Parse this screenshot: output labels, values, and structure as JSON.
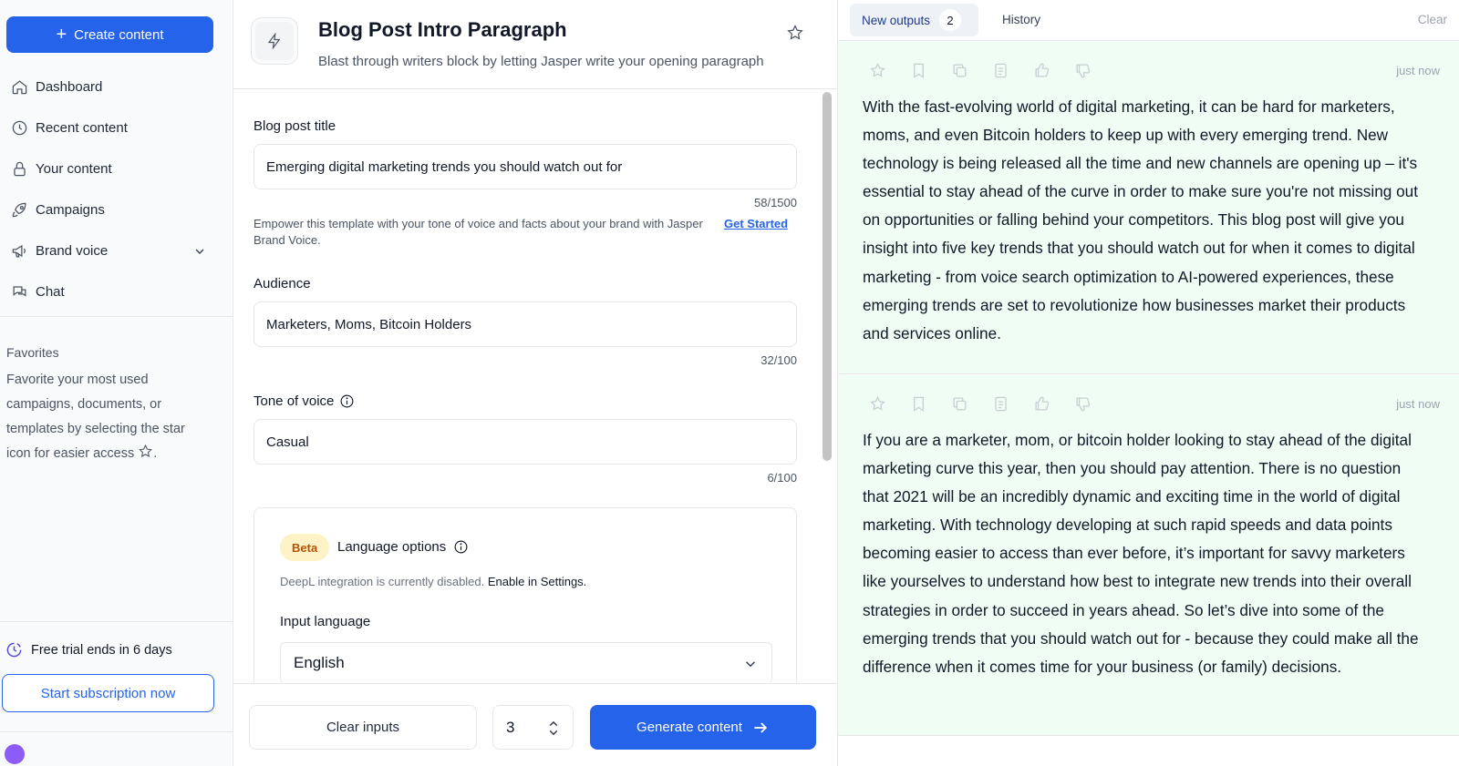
{
  "sidebar": {
    "create_label": "Create content",
    "nav": [
      {
        "label": "Dashboard",
        "icon": "home-icon"
      },
      {
        "label": "Recent content",
        "icon": "clock-icon"
      },
      {
        "label": "Your content",
        "icon": "lock-icon"
      },
      {
        "label": "Campaigns",
        "icon": "rocket-icon"
      },
      {
        "label": "Brand voice",
        "icon": "megaphone-icon"
      },
      {
        "label": "Chat",
        "icon": "chat-icon"
      }
    ],
    "favorites_title": "Favorites",
    "favorites_text": "Favorite your most used campaigns, documents, or templates by selecting the star icon for easier access",
    "favorites_suffix": ".",
    "trial_text": "Free trial ends in 6 days",
    "subscribe_label": "Start subscription now"
  },
  "template": {
    "title": "Blog Post Intro Paragraph",
    "subtitle": "Blast through writers block by letting Jasper write your opening paragraph"
  },
  "form": {
    "title_label": "Blog post title",
    "title_value": "Emerging digital marketing trends you should watch out for",
    "title_count": "58/1500",
    "brand_hint": "Empower this template with your tone of voice and facts about your brand with Jasper Brand Voice.",
    "brand_link": "Get Started",
    "audience_label": "Audience",
    "audience_value": "Marketers, Moms, Bitcoin Holders",
    "audience_count": "32/100",
    "tone_label": "Tone of voice",
    "tone_value": "Casual",
    "tone_count": "6/100",
    "beta_label": "Beta",
    "lang_title": "Language options",
    "deepl_text": "DeepL integration is currently disabled.",
    "deepl_link": "Enable in Settings.",
    "input_lang_label": "Input language",
    "input_lang_value": "English"
  },
  "footer": {
    "clear_label": "Clear inputs",
    "quantity": "3",
    "generate_label": "Generate content"
  },
  "outputs": {
    "tab_new": "New outputs",
    "tab_new_count": "2",
    "tab_history": "History",
    "clear_label": "Clear",
    "items": [
      {
        "time": "just now",
        "text": "With the fast-evolving world of digital marketing, it can be hard for marketers, moms, and even Bitcoin holders to keep up with every emerging trend. New technology is being released all the time and new channels are opening up – it's essential to stay ahead of the curve in order to make sure you're not missing out on opportunities or falling behind your competitors. This blog post will give you insight into five key trends that you should watch out for when it comes to digital marketing - from voice search optimization to AI-powered experiences, these emerging trends are set to revolutionize how businesses market their products and services online."
      },
      {
        "time": "just now",
        "text": "If you are a marketer, mom, or bitcoin holder looking to stay ahead of the digital marketing curve this year, then you should pay attention. There is no question that 2021 will be an incredibly dynamic and exciting time in the world of digital marketing. With technology developing at such rapid speeds and data points becoming easier to access than ever before, it’s important for savvy marketers like yourselves to understand how best to integrate new trends into their overall strategies in order to succeed in years ahead. So let’s dive into some of the emerging trends that you should watch out for - because they could make all the difference when it comes time for your business (or family) decisions."
      }
    ]
  },
  "colors": {
    "accent": "#2563eb",
    "output_bg": "#f0fdf4",
    "beta_bg": "#fef3c7"
  }
}
